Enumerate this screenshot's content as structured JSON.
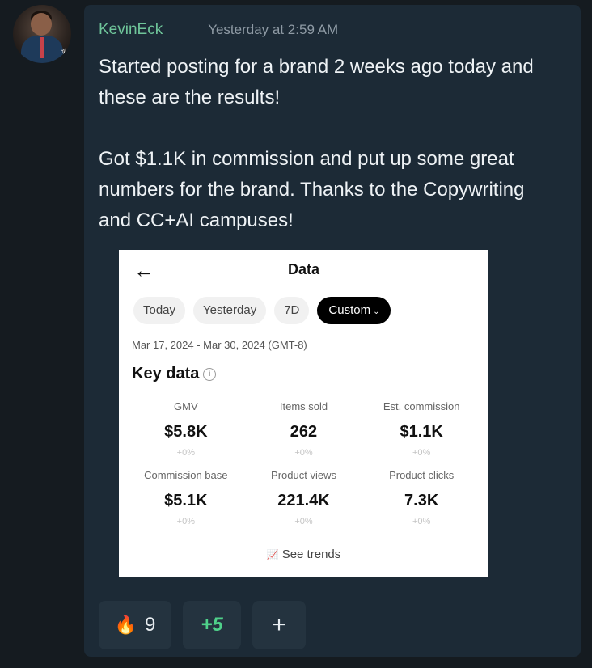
{
  "post": {
    "username": "KevinEck",
    "timestamp": "Yesterday at 2:59 AM",
    "paragraph1": "Started posting for a brand 2 weeks ago today and these are the results!",
    "paragraph2": "Got $1.1K in commission and put up some great numbers for the brand. Thanks to the Copywriting and CC+AI campuses!"
  },
  "screenshot": {
    "back_icon": "←",
    "title": "Data",
    "chips": [
      "Today",
      "Yesterday",
      "7D",
      "Custom"
    ],
    "date_range": "Mar 17, 2024 - Mar 30, 2024 (GMT-8)",
    "section_title": "Key data",
    "metrics": [
      {
        "label": "GMV",
        "value": "$5.8K",
        "delta": "+0%"
      },
      {
        "label": "Items sold",
        "value": "262",
        "delta": "+0%"
      },
      {
        "label": "Est. commission",
        "value": "$1.1K",
        "delta": "+0%"
      },
      {
        "label": "Commission base",
        "value": "$5.1K",
        "delta": "+0%"
      },
      {
        "label": "Product views",
        "value": "221.4K",
        "delta": "+0%"
      },
      {
        "label": "Product clicks",
        "value": "7.3K",
        "delta": "+0%"
      }
    ],
    "see_trends": "See trends"
  },
  "reactions": {
    "fire_count": "9",
    "boost_label": "+5",
    "add_label": "+"
  },
  "colors": {
    "background": "#151b20",
    "card": "#1c2a36",
    "username": "#6fc59a",
    "boost": "#4fd18a"
  },
  "icons": [
    "fire-icon",
    "info-icon",
    "trend-chart-icon",
    "back-arrow-icon",
    "chevron-down-icon"
  ]
}
